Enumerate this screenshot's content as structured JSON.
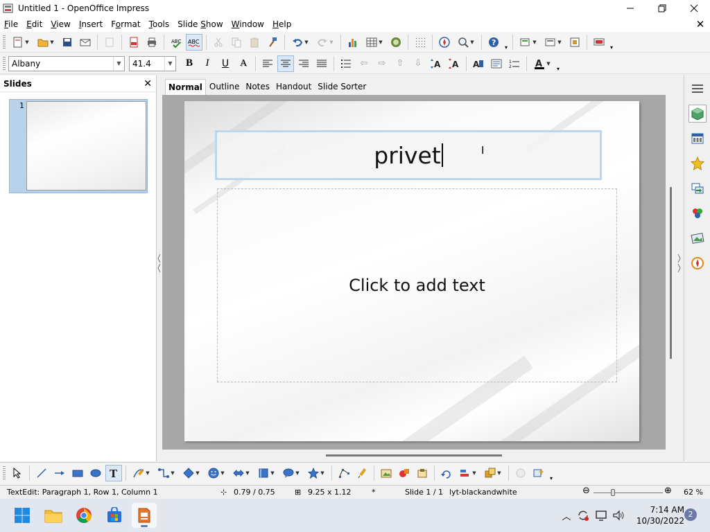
{
  "window": {
    "title": "Untitled 1 - OpenOffice Impress",
    "minimize_icon": "minimize-icon",
    "maximize_icon": "restore-icon",
    "close_icon": "close-icon"
  },
  "menu": [
    {
      "pre": "",
      "u": "F",
      "post": "ile"
    },
    {
      "pre": "",
      "u": "E",
      "post": "dit"
    },
    {
      "pre": "",
      "u": "V",
      "post": "iew"
    },
    {
      "pre": "",
      "u": "I",
      "post": "nsert"
    },
    {
      "pre": "F",
      "u": "o",
      "post": "rmat"
    },
    {
      "pre": "",
      "u": "T",
      "post": "ools"
    },
    {
      "pre": "Slide ",
      "u": "S",
      "post": "how"
    },
    {
      "pre": "",
      "u": "W",
      "post": "indow"
    },
    {
      "pre": "",
      "u": "H",
      "post": "elp"
    }
  ],
  "formatting": {
    "font_name": "Albany",
    "font_size": "41.4"
  },
  "slides_pane": {
    "title": "Slides",
    "thumb_number": "1"
  },
  "view_tabs": [
    "Normal",
    "Outline",
    "Notes",
    "Handout",
    "Slide Sorter"
  ],
  "slide": {
    "title_text": "privet",
    "body_placeholder": "Click to add text"
  },
  "status": {
    "edit_info": "TextEdit: Paragraph 1, Row 1, Column 1",
    "position": "0.79 / 0.75",
    "size": "9.25 x 1.12",
    "modified": "*",
    "slide": "Slide 1 / 1",
    "layout": "lyt-blackandwhite",
    "zoom": "62 %"
  },
  "taskbar": {
    "time": "7:14 AM",
    "date": "10/30/2022",
    "notifications": "2"
  },
  "colors": {
    "selection": "#b8d2ec",
    "title_frame": "#bcd6ef",
    "canvas": "#a7a7a7"
  }
}
